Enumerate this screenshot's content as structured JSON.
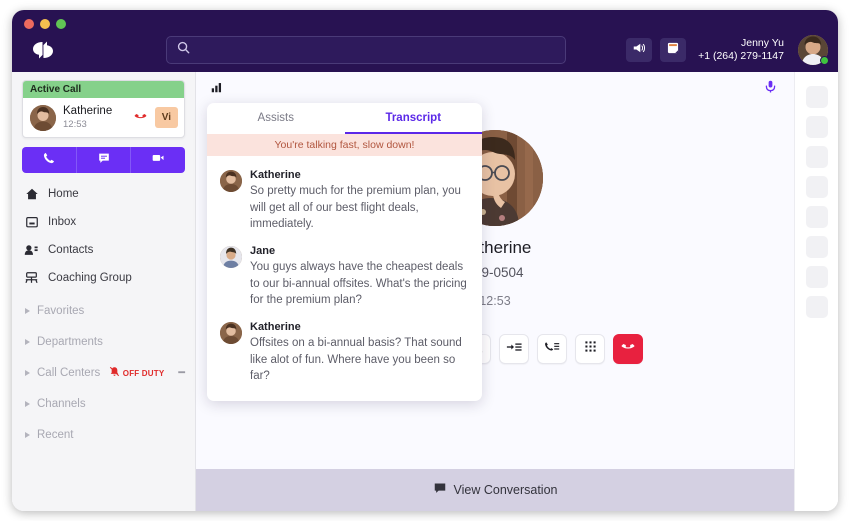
{
  "window": {
    "traffic_lights": [
      "close",
      "minimize",
      "maximize"
    ]
  },
  "header": {
    "logo_name": "app-logo",
    "search": {
      "value": "",
      "placeholder": ""
    },
    "announcement_icon": "megaphone-icon",
    "notes_icon": "notes-icon",
    "user": {
      "name": "Jenny Yu",
      "phone": "+1 (264) 279-1147",
      "presence": "online",
      "avatar": "user-avatar"
    }
  },
  "sidebar": {
    "active_call": {
      "banner": "Active Call",
      "contact_name": "Katherine",
      "duration": "12:53",
      "hangup_icon": "hangup-icon",
      "badge": "Vi"
    },
    "quick_actions": [
      {
        "name": "phone-button",
        "icon": "phone-icon"
      },
      {
        "name": "message-button",
        "icon": "message-icon"
      },
      {
        "name": "video-button",
        "icon": "video-icon"
      }
    ],
    "nav": [
      {
        "label": "Home",
        "icon": "home-icon"
      },
      {
        "label": "Inbox",
        "icon": "inbox-icon"
      },
      {
        "label": "Contacts",
        "icon": "contacts-icon"
      },
      {
        "label": "Coaching Group",
        "icon": "coaching-group-icon"
      }
    ],
    "sections": [
      {
        "label": "Favorites",
        "badge": ""
      },
      {
        "label": "Departments",
        "badge": ""
      },
      {
        "label": "Call Centers",
        "badge": "OFF DUTY"
      },
      {
        "label": "Channels",
        "badge": ""
      },
      {
        "label": "Recent",
        "badge": ""
      }
    ]
  },
  "main": {
    "signal_icon": "signal-bars-icon",
    "mic_icon": "microphone-icon",
    "call": {
      "contact_name": "Katherine",
      "phone": "649-0504",
      "timer": "12:53",
      "avatar": "caller-avatar"
    },
    "controls": [
      {
        "name": "record-button",
        "icon": "rec-icon"
      },
      {
        "name": "mute-button",
        "icon": "microphone-icon"
      },
      {
        "name": "hold-button",
        "icon": "pause-icon"
      },
      {
        "name": "add-participant-button",
        "icon": "add-person-icon"
      },
      {
        "name": "transfer-button",
        "icon": "transfer-icon"
      },
      {
        "name": "call-options-button",
        "icon": "phone-list-icon"
      },
      {
        "name": "keypad-button",
        "icon": "keypad-icon"
      },
      {
        "name": "end-call-button",
        "icon": "hangup-icon"
      }
    ],
    "bottom_bar": {
      "label": "View Conversation",
      "icon": "chat-icon"
    }
  },
  "transcript": {
    "tabs": [
      {
        "label": "Assists",
        "active": false
      },
      {
        "label": "Transcript",
        "active": true
      }
    ],
    "alert": "You're talking fast, slow down!",
    "messages": [
      {
        "speaker": "Katherine",
        "text": "So pretty much for the premium plan, you will get all of our best flight deals, immediately."
      },
      {
        "speaker": "Jane",
        "text": "You guys always have the cheapest deals to our bi-annual offsites. What's the pricing for the premium plan?"
      },
      {
        "speaker": "Katherine",
        "text": "Offsites on a bi-annual basis? That sound like alot of fun. Where have you been so far?"
      }
    ]
  },
  "right_rail": {
    "tile_count": 8
  },
  "colors": {
    "header_bg": "#281252",
    "accent_purple": "#6b2ff5",
    "active_tab": "#5b28e8",
    "active_call_green": "#85d18a",
    "badge_peach": "#f8c9a2",
    "alert_bg": "#fbe3dd",
    "alert_text": "#b1563f",
    "danger_red": "#e8213f",
    "off_duty_red": "#e02b2b",
    "bottom_bar": "#d4d0e2"
  }
}
